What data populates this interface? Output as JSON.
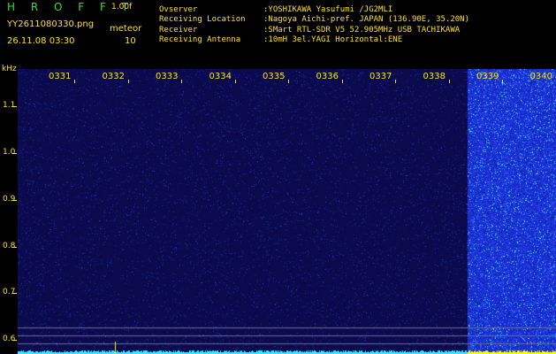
{
  "header": {
    "app_title": "H R O F F T",
    "version": "1.00f",
    "filename": "YY2611080330.png",
    "datetime": "26.11.08 03:30",
    "meteor_label": "meteor",
    "meteor_count": "10",
    "info": [
      {
        "key": "Ovserver",
        "value": ":YOSHIKAWA Yasufumi /JG2MLI"
      },
      {
        "key": "Receiving Location",
        "value": ":Nagoya Aichi-pref. JAPAN (136.90E, 35.20N)"
      },
      {
        "key": "Receiver",
        "value": ":SMart RTL-SDR V5 52.905MHz USB TACHIKAWA"
      },
      {
        "key": "Receiving Antenna",
        "value": ":10mH 3el.YAGI Horizontal:ENE"
      }
    ]
  },
  "chart_data": {
    "type": "heatmap",
    "ylabel": "kHz",
    "y_ticks": [
      "1.1",
      "1.0",
      "0.9",
      "0.8",
      "0.7",
      "0.6"
    ],
    "y_range": [
      0.57,
      1.18
    ],
    "x_ticks": [
      "0331",
      "0332",
      "0333",
      "0334",
      "0335",
      "0336",
      "0337",
      "0338",
      "0339",
      "0340"
    ],
    "colors": {
      "background": "#0a0a4d",
      "noise": "#2a3fe0",
      "burst": "#2e5bff",
      "hot": "#39e6ff",
      "peak": "#ffff00"
    }
  }
}
